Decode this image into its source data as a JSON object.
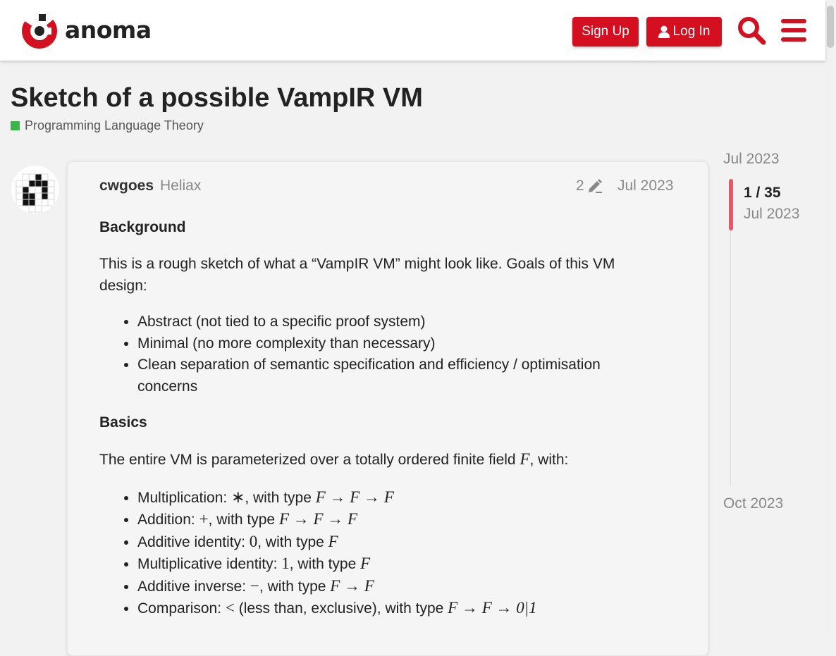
{
  "header": {
    "logo_text": "anoma",
    "signup_label": "Sign Up",
    "login_label": "Log In",
    "brand_color": "#d40f20"
  },
  "topic": {
    "title": "Sketch of a possible VampIR VM",
    "category": "Programming Language Theory",
    "category_color": "#3ab54a"
  },
  "post": {
    "username": "cwgoes",
    "user_title": "Heliax",
    "edit_count": "2",
    "date": "Jul 2023",
    "background_heading": "Background",
    "intro_line": "This is a rough sketch of what a “VampIR VM” might look like. Goals of this VM design:",
    "goals": [
      "Abstract (not tied to a specific proof system)",
      "Minimal (no more complexity than necessary)",
      "Clean separation of semantic specification and efficiency / optimisation concerns"
    ],
    "basics_heading": "Basics",
    "basics_intro_a": "The entire VM is parameterized over a totally ordered finite field ",
    "basics_intro_var": "F",
    "basics_intro_b": ", with:",
    "operations": [
      {
        "label": "Multiplication: ",
        "symbol": "∗",
        "mid": ", with type ",
        "type": "F → F → F"
      },
      {
        "label": "Addition: ",
        "symbol": "+",
        "mid": ", with type ",
        "type": "F → F → F"
      },
      {
        "label": "Additive identity: ",
        "symbol": "0",
        "mid": ", with type ",
        "type": "F"
      },
      {
        "label": "Multiplicative identity: ",
        "symbol": "1",
        "mid": ", with type ",
        "type": "F"
      },
      {
        "label": "Additive inverse: ",
        "symbol": "−",
        "mid": ", with type ",
        "type": "F → F"
      },
      {
        "label": "Comparison: ",
        "symbol": "<",
        "mid": " (less than, exclusive), with type ",
        "type": "F → F → 0|1"
      }
    ]
  },
  "timeline": {
    "start_date": "Jul 2023",
    "position": "1 / 35",
    "position_date": "Jul 2023",
    "end_date": "Oct 2023",
    "handle_color": "#e45867"
  },
  "icons": {
    "logo": "anoma-logo-icon",
    "login": "user-icon",
    "search": "search-icon",
    "menu": "hamburger-menu-icon",
    "edit": "pencil-icon"
  }
}
